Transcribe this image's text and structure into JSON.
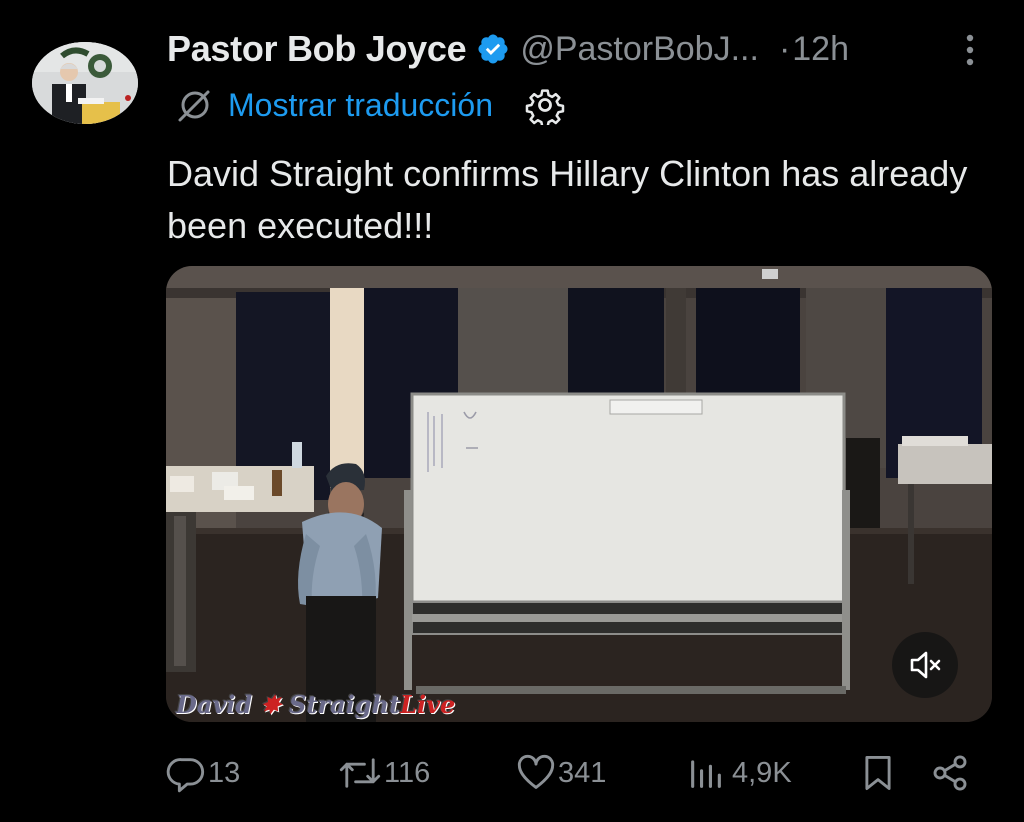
{
  "tweet": {
    "display_name": "Pastor Bob Joyce",
    "handle": "@PastorBobJ...",
    "separator": "·",
    "time": "12h",
    "translate_label": "Mostrar traducción",
    "text": "David Straight confirms Hillary Clinton has already been executed!!!",
    "verified": true
  },
  "media": {
    "watermark_left": "David",
    "watermark_mid": "Straight",
    "watermark_right": "Live",
    "muted": true
  },
  "actions": {
    "replies": "13",
    "reposts": "116",
    "likes": "341",
    "views": "4,9K"
  },
  "colors": {
    "background": "#000000",
    "text": "#e7e9ea",
    "secondary": "#8b9095",
    "link": "#1d9bf0",
    "verified": "#1d9bf0"
  },
  "icons": {
    "verified": "verified-badge-icon",
    "more": "more-options-icon",
    "translate": "translate-icon",
    "settings": "gear-icon",
    "mute": "mute-icon",
    "reply": "reply-icon",
    "repost": "repost-icon",
    "like": "heart-icon",
    "views": "views-icon",
    "bookmark": "bookmark-icon",
    "share": "share-icon"
  }
}
